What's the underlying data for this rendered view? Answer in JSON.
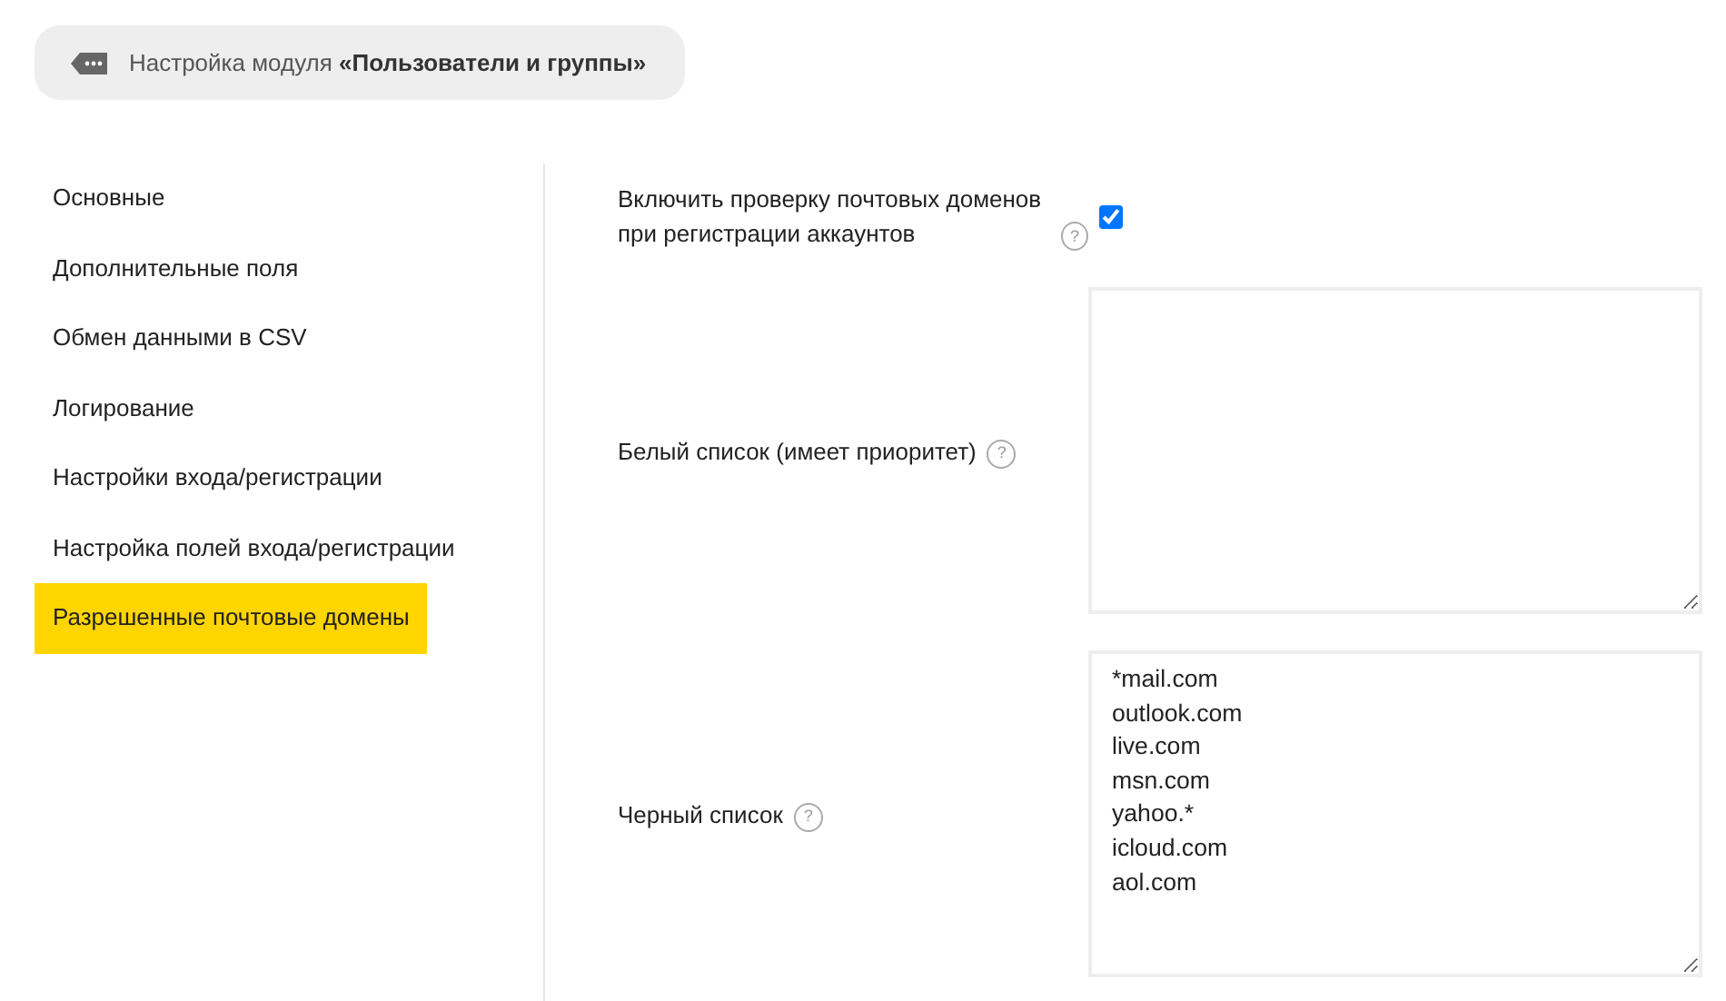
{
  "header": {
    "title": "Настройка модуля **«Пользователи и группы»**"
  },
  "sidebar": {
    "items": [
      {
        "label": "Основные",
        "selected": false
      },
      {
        "label": "Дополнительные поля",
        "selected": false
      },
      {
        "label": "Обмен данными в CSV",
        "selected": false
      },
      {
        "label": "Логирование",
        "selected": false
      },
      {
        "label": "Настройки входа/регистрации",
        "selected": false
      },
      {
        "label": "Настройка полей входа/регистрации",
        "selected": false
      },
      {
        "label": "Разрешенные почтовые домены",
        "selected": true
      }
    ]
  },
  "fields": [
    {
      "kind": "checkbox",
      "label": "Включить проверку почтовых доменов при регистрации аккаунтов",
      "help": "?",
      "checked": true
    },
    {
      "kind": "textarea",
      "label": "Белый список (имеет приоритет)",
      "help": "?"
    },
    {
      "kind": "textarea",
      "label": "Черный список",
      "help": "?",
      "value": "*mail.com\noutlook.com\nlive.com\nmsn.com\nyahoo.*\nicloud.com\naol.com"
    }
  ]
}
